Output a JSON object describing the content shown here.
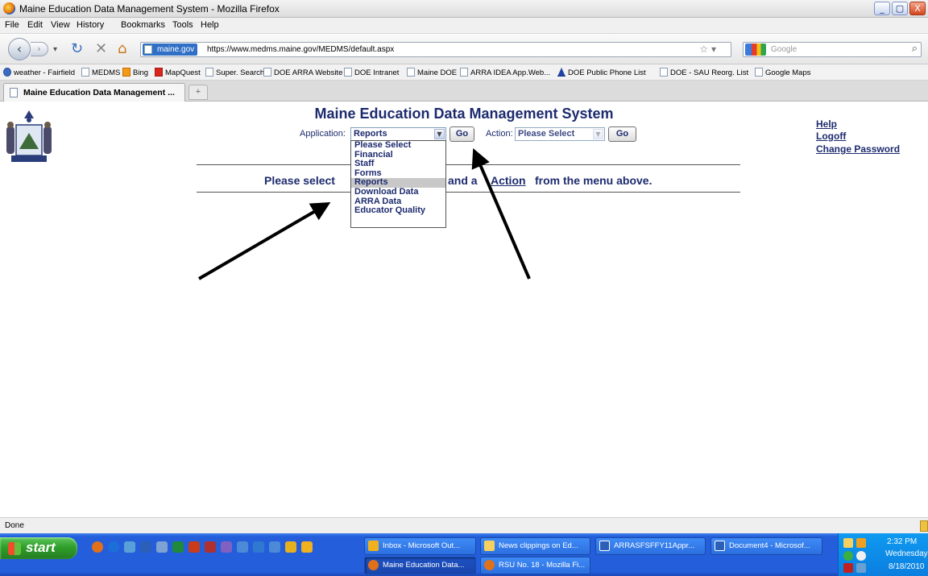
{
  "window": {
    "title": "Maine Education Data Management System - Mozilla Firefox",
    "min": "_",
    "max": "▢",
    "close": "X"
  },
  "menu": [
    "File",
    "Edit",
    "View",
    "History",
    "Bookmarks",
    "Tools",
    "Help"
  ],
  "nav": {
    "site_badge": "maine.gov",
    "url": "https://www.medms.maine.gov/MEDMS/default.aspx",
    "search_placeholder": "Google"
  },
  "bookmarks": [
    "weather - Fairfield",
    "MEDMS",
    "Bing",
    "MapQuest",
    "Super. Search",
    "DOE ARRA Website",
    "DOE Intranet",
    "Maine DOE",
    "ARRA IDEA App.Web...",
    "DOE Public Phone List",
    "DOE - SAU Reorg. List",
    "Google Maps"
  ],
  "tab": {
    "label": "Maine Education Data Management ...",
    "new_tab": "+"
  },
  "page": {
    "title": "Maine Education Data Management System",
    "application_label": "Application:",
    "application_value": "Reports",
    "go_label": "Go",
    "action_label": "Action:",
    "action_value": "Please Select",
    "links": {
      "help": "Help",
      "logoff": "Logoff",
      "change_password": "Change Password"
    },
    "message_part1": "Please select",
    "message_part2": "and a",
    "message_action": "Action",
    "message_part3": "from the menu above.",
    "dropdown_options": [
      "Please Select",
      "Financial",
      "Staff",
      "Forms",
      "Reports",
      "Download Data",
      "ARRA Data",
      "Educator Quality"
    ],
    "dropdown_selected": "Reports"
  },
  "status": {
    "text": "Done"
  },
  "taskbar": {
    "start": "start",
    "buttons_row1": [
      "Inbox - Microsoft Out...",
      "News clippings on Ed...",
      "ARRASFSFFY11Appr...",
      "Document4 - Microsof..."
    ],
    "buttons_row2": [
      "Maine Education Data...",
      "RSU No. 18 - Mozilla Fi..."
    ],
    "clock": "2:32 PM",
    "day": "Wednesday",
    "date": "8/18/2010"
  }
}
